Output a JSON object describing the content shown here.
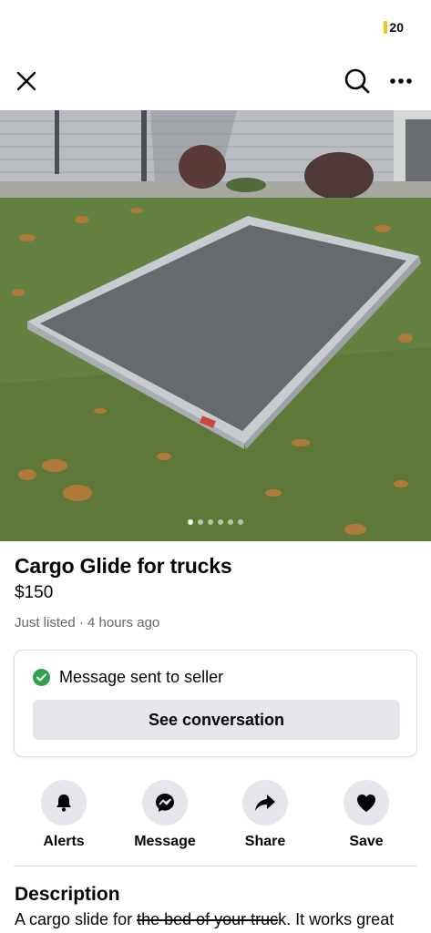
{
  "status_bar": {
    "battery_text": "20",
    "battery_color": "#f5c518"
  },
  "nav": {
    "close_icon": "close-icon",
    "search_icon": "search-icon",
    "more_icon": "more-icon"
  },
  "photo": {
    "description_icon": "listing-photo",
    "image_count": 6,
    "active_index": 0
  },
  "listing": {
    "title": "Cargo Glide for trucks",
    "price": "$150",
    "meta": "Just listed · 4 hours ago"
  },
  "message_card": {
    "status_text": "Message sent to seller",
    "button_label": "See conversation",
    "check_color": "#31a24c"
  },
  "actions": [
    {
      "label": "Alerts",
      "icon": "bell-icon"
    },
    {
      "label": "Message",
      "icon": "messenger-icon"
    },
    {
      "label": "Share",
      "icon": "share-icon"
    },
    {
      "label": "Save",
      "icon": "heart-icon"
    }
  ],
  "description": {
    "title": "Description",
    "text_before": "A cargo slide for ",
    "text_struck": "the bed of your truc",
    "text_after": "k. It works great"
  }
}
